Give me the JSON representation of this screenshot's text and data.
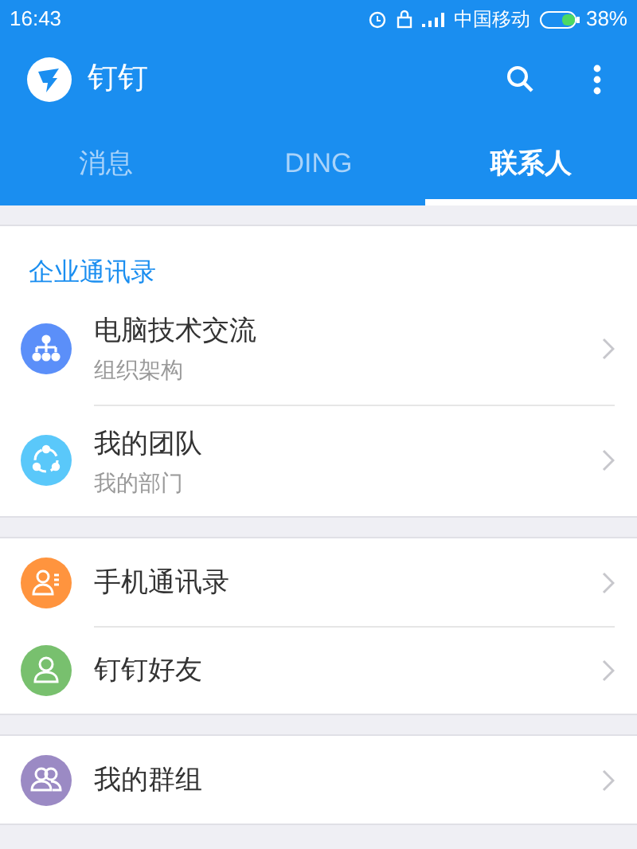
{
  "status_bar": {
    "time": "16:43",
    "carrier": "中国移动",
    "battery": "38%"
  },
  "app_bar": {
    "title": "钉钉"
  },
  "tabs": [
    {
      "label": "消息",
      "selected": false
    },
    {
      "label": "DING",
      "selected": false
    },
    {
      "label": "联系人",
      "selected": true
    }
  ],
  "sections": [
    {
      "heading": "企业通讯录",
      "items": [
        {
          "title": "电脑技术交流",
          "subtitle": "组织架构",
          "kind": "org",
          "color": "#5b8ff9"
        },
        {
          "title": "我的团队",
          "subtitle": "我的部门",
          "kind": "team",
          "color": "#5ac8fa"
        }
      ]
    },
    {
      "items": [
        {
          "title": "手机通讯录",
          "kind": "phonebook",
          "color": "#ff943e"
        },
        {
          "title": "钉钉好友",
          "kind": "friend",
          "color": "#78c06e"
        }
      ]
    },
    {
      "items": [
        {
          "title": "我的群组",
          "kind": "group",
          "color": "#9b8ac4"
        }
      ]
    }
  ]
}
